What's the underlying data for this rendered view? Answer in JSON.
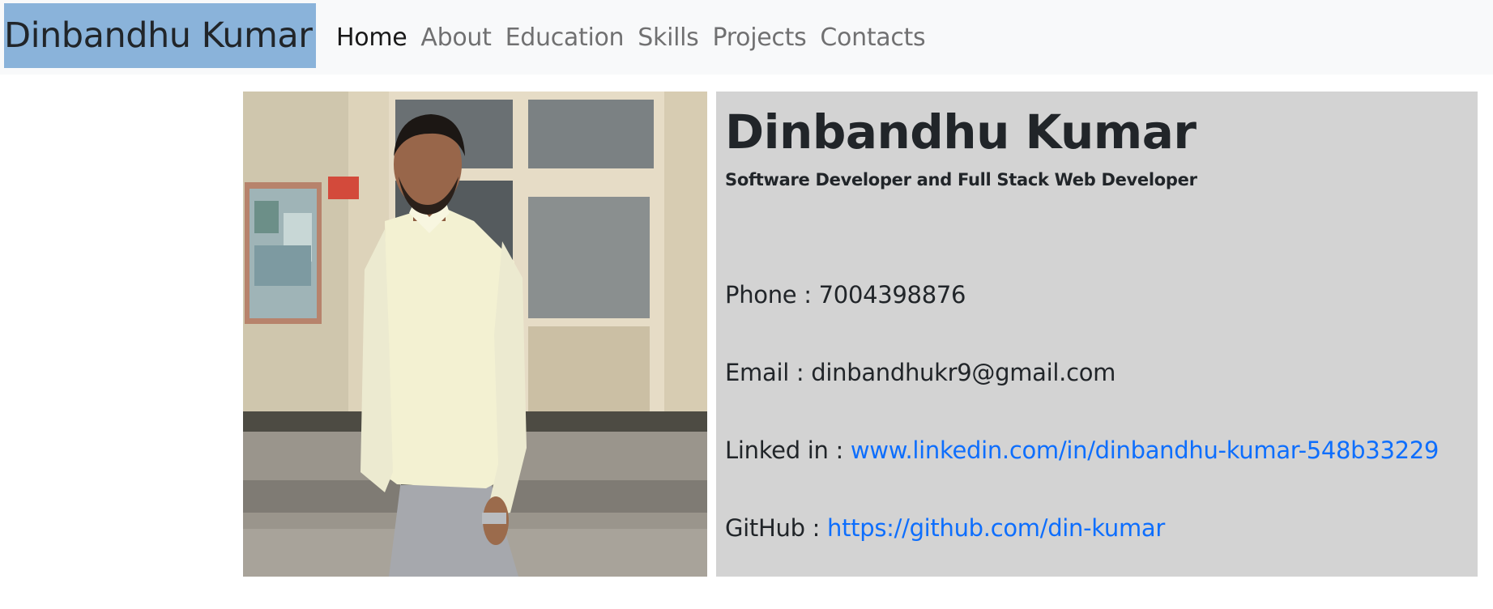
{
  "navbar": {
    "brand": "Dinbandhu Kumar",
    "links": [
      "Home",
      "About",
      "Education",
      "Skills",
      "Projects",
      "Contacts"
    ],
    "active": "Home"
  },
  "profile": {
    "name": "Dinbandhu Kumar",
    "subtitle": "Software Developer and Full Stack Web Developer",
    "phone_label": "Phone : ",
    "phone": "7004398876",
    "email_label": "Email : ",
    "email": "dinbandhukr9@gmail.com",
    "linkedin_label": "Linked in : ",
    "linkedin": "www.linkedin.com/in/dinbandhu-kumar-548b33229",
    "github_label": "GitHub : ",
    "github": "https://github.com/din-kumar"
  },
  "colors": {
    "brand_bg": "#8ab3da",
    "navbar_bg": "#f8f9fa",
    "info_bg": "#d3d3d3",
    "link": "#0d6efd"
  }
}
